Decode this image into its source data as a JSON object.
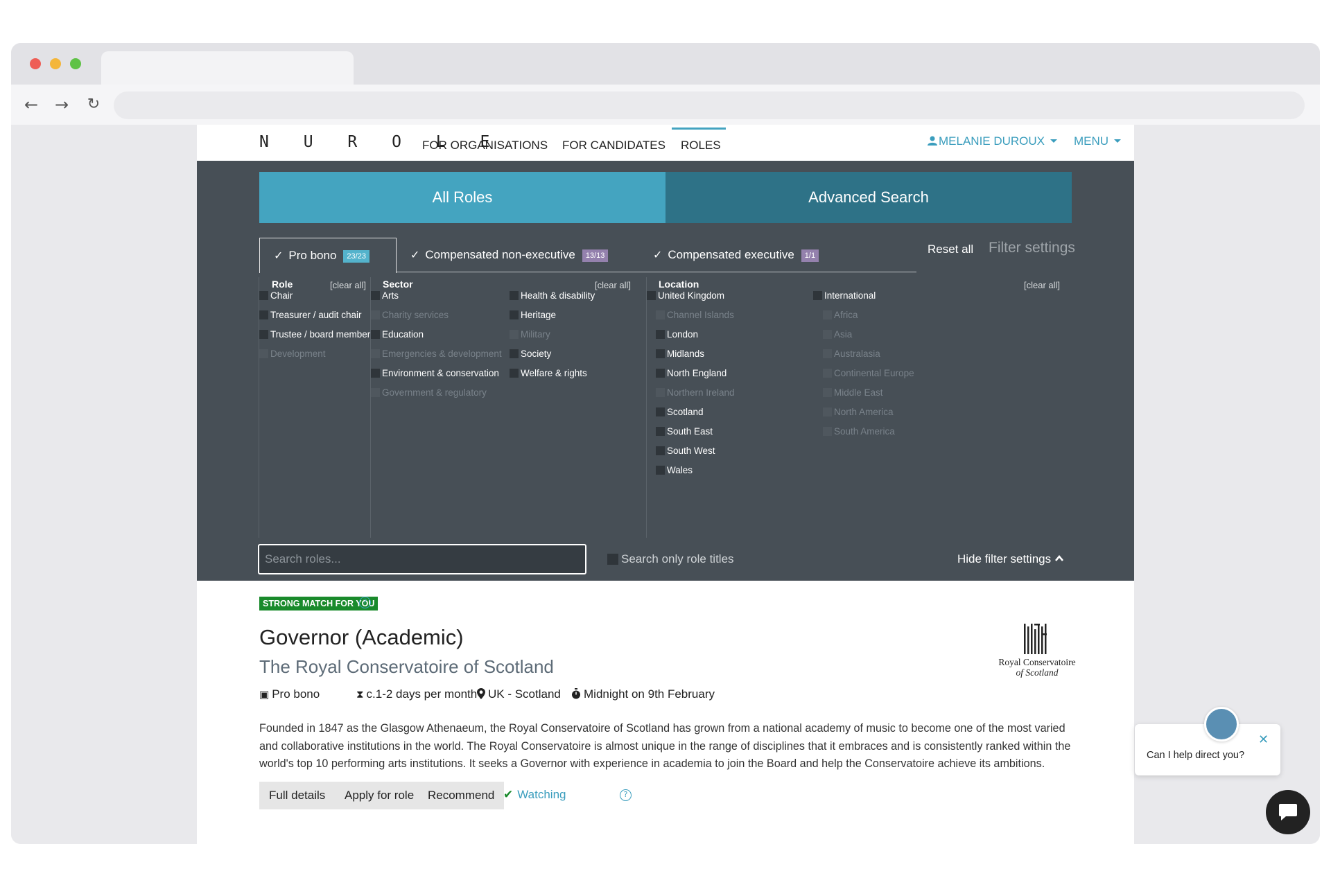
{
  "site": {
    "logo": "N U R O L E",
    "nav": [
      "FOR ORGANISATIONS",
      "FOR CANDIDATES",
      "ROLES"
    ],
    "user_name": "MELANIE DUROUX",
    "menu_label": "MENU"
  },
  "tabs": {
    "all_roles": "All Roles",
    "advanced_search": "Advanced Search"
  },
  "compensation_tabs": [
    {
      "label": "Pro bono",
      "badge": "23/23",
      "checked": true
    },
    {
      "label": "Compensated non-executive",
      "badge": "13/13",
      "checked": true
    },
    {
      "label": "Compensated executive",
      "badge": "1/1",
      "checked": true
    }
  ],
  "filter_actions": {
    "reset_all": "Reset all",
    "filter_settings": "Filter settings",
    "clear_all": "[clear all]"
  },
  "filters": {
    "role": {
      "title": "Role",
      "options": [
        {
          "label": "Chair",
          "enabled": true
        },
        {
          "label": "Treasurer / audit chair",
          "enabled": true
        },
        {
          "label": "Trustee / board member",
          "enabled": true
        },
        {
          "label": "Development",
          "enabled": false
        }
      ]
    },
    "sector": {
      "title": "Sector",
      "options_left": [
        {
          "label": "Arts",
          "enabled": true
        },
        {
          "label": "Charity services",
          "enabled": false
        },
        {
          "label": "Education",
          "enabled": true
        },
        {
          "label": "Emergencies & development",
          "enabled": false
        },
        {
          "label": "Environment & conservation",
          "enabled": true
        },
        {
          "label": "Government & regulatory",
          "enabled": false
        }
      ],
      "options_right": [
        {
          "label": "Health & disability",
          "enabled": true
        },
        {
          "label": "Heritage",
          "enabled": true
        },
        {
          "label": "Military",
          "enabled": false
        },
        {
          "label": "Society",
          "enabled": true
        },
        {
          "label": "Welfare & rights",
          "enabled": true
        }
      ]
    },
    "location": {
      "title": "Location",
      "uk": {
        "label": "United Kingdom",
        "options": [
          {
            "label": "Channel Islands",
            "enabled": false
          },
          {
            "label": "London",
            "enabled": true
          },
          {
            "label": "Midlands",
            "enabled": true
          },
          {
            "label": "North England",
            "enabled": true
          },
          {
            "label": "Northern Ireland",
            "enabled": false
          },
          {
            "label": "Scotland",
            "enabled": true
          },
          {
            "label": "South East",
            "enabled": true
          },
          {
            "label": "South West",
            "enabled": true
          },
          {
            "label": "Wales",
            "enabled": true
          }
        ]
      },
      "international": {
        "label": "International",
        "options": [
          {
            "label": "Africa",
            "enabled": false
          },
          {
            "label": "Asia",
            "enabled": false
          },
          {
            "label": "Australasia",
            "enabled": false
          },
          {
            "label": "Continental Europe",
            "enabled": false
          },
          {
            "label": "Middle East",
            "enabled": false
          },
          {
            "label": "North America",
            "enabled": false
          },
          {
            "label": "South America",
            "enabled": false
          }
        ]
      }
    }
  },
  "search": {
    "placeholder": "Search roles...",
    "only_titles_label": "Search only role titles",
    "hide_filter_label": "Hide filter settings"
  },
  "result": {
    "match_badge": "STRONG MATCH FOR YOU",
    "title": "Governor (Academic)",
    "organisation": "The Royal Conservatoire of Scotland",
    "meta": {
      "compensation": "Pro bono",
      "time_commitment": "c.1-2 days per month",
      "location": "UK - Scotland",
      "deadline": "Midnight on 9th February"
    },
    "description": "Founded in 1847 as the Glasgow Athenaeum, the Royal Conservatoire of Scotland has grown from a national academy of music to become one of the most varied and collaborative institutions in the world. The Royal Conservatoire is almost unique in the range of disciplines that it embraces and is consistently ranked within the world's top 10 performing arts institutions. It seeks a Governor with experience in academia to join the Board and help the Conservatoire achieve its ambitions.",
    "buttons": [
      "Full details",
      "Apply for role",
      "Recommend"
    ],
    "watching_label": "Watching",
    "logo_text_line1": "Royal Conservatoire",
    "logo_text_line2": "of Scotland"
  },
  "chat": {
    "prompt": "Can I help direct you?"
  },
  "colors": {
    "accent": "#44a4c0",
    "accent_dark": "#2e7287",
    "panel_bg": "#474f56",
    "match_green": "#198a2b",
    "link_blue": "#3a9dbd"
  }
}
